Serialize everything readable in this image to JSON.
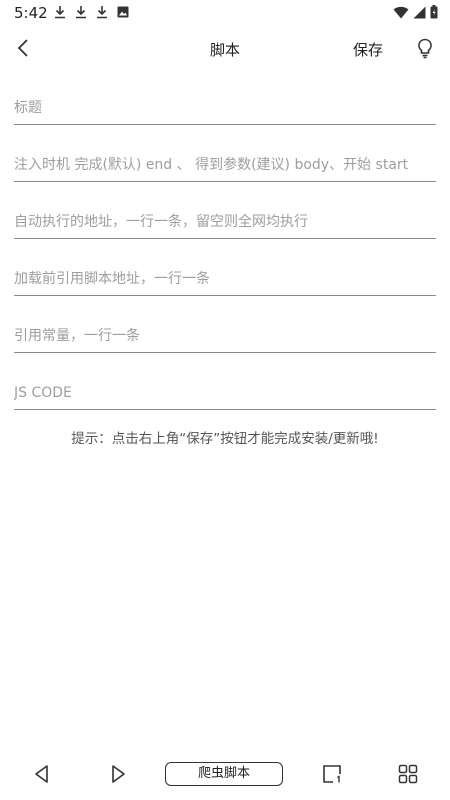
{
  "status_bar": {
    "time": "5:42",
    "icons": [
      "download-icon",
      "download-icon",
      "download-icon",
      "image-icon"
    ],
    "right_icons": [
      "wifi-icon",
      "signal-icon",
      "battery-icon"
    ]
  },
  "app_bar": {
    "title": "脚本",
    "save_label": "保存",
    "back_icon": "chevron-left-icon",
    "tip_icon": "lightbulb-icon"
  },
  "form": {
    "title_placeholder": "标题",
    "inject_placeholder": "注入时机 完成(默认) end 、 得到参数(建议) body、开始 start",
    "auto_urls_placeholder": "自动执行的地址，一行一条，留空则全网均执行",
    "preload_placeholder": "加载前引用脚本地址，一行一条",
    "constants_placeholder": "引用常量，一行一条",
    "code_placeholder": "JS CODE"
  },
  "hint_text": "提示：点击右上角“保存”按钮才能完成安装/更新哦!",
  "bottom_nav": {
    "center_label": "爬虫脚本",
    "icons": [
      "back-triangle-icon",
      "forward-triangle-icon",
      "tabs-icon",
      "grid-icon"
    ]
  }
}
